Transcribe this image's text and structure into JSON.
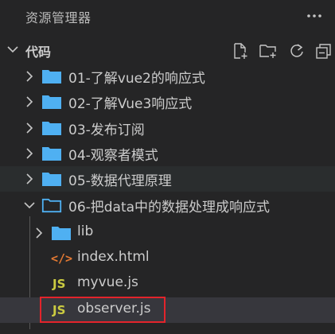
{
  "panel": {
    "title": "资源管理器",
    "more_icon": "ellipsis-icon"
  },
  "section": {
    "label": "代码",
    "actions": [
      {
        "name": "new-file-icon"
      },
      {
        "name": "new-folder-icon"
      },
      {
        "name": "refresh-icon"
      },
      {
        "name": "collapse-all-icon"
      }
    ]
  },
  "tree": {
    "folders": [
      {
        "label": "01-了解vue2的响应式"
      },
      {
        "label": "02-了解Vue3响应式"
      },
      {
        "label": "03-发布订阅"
      },
      {
        "label": "04-观察者模式"
      },
      {
        "label": "05-数据代理原理"
      },
      {
        "label": "06-把data中的数据处理成响应式"
      }
    ],
    "children": [
      {
        "label": "lib",
        "type": "folder"
      },
      {
        "label": "index.html",
        "type": "html",
        "icon_text": "</>"
      },
      {
        "label": "myvue.js",
        "type": "js",
        "icon_text": "JS"
      },
      {
        "label": "observer.js",
        "type": "js",
        "icon_text": "JS"
      }
    ]
  },
  "colors": {
    "background": "#252526",
    "folder_blue": "#4fb0f2",
    "js_yellow": "#cbcb41",
    "html_orange": "#e37933",
    "highlight_red": "#e3242b",
    "selected_row": "#37373d"
  }
}
